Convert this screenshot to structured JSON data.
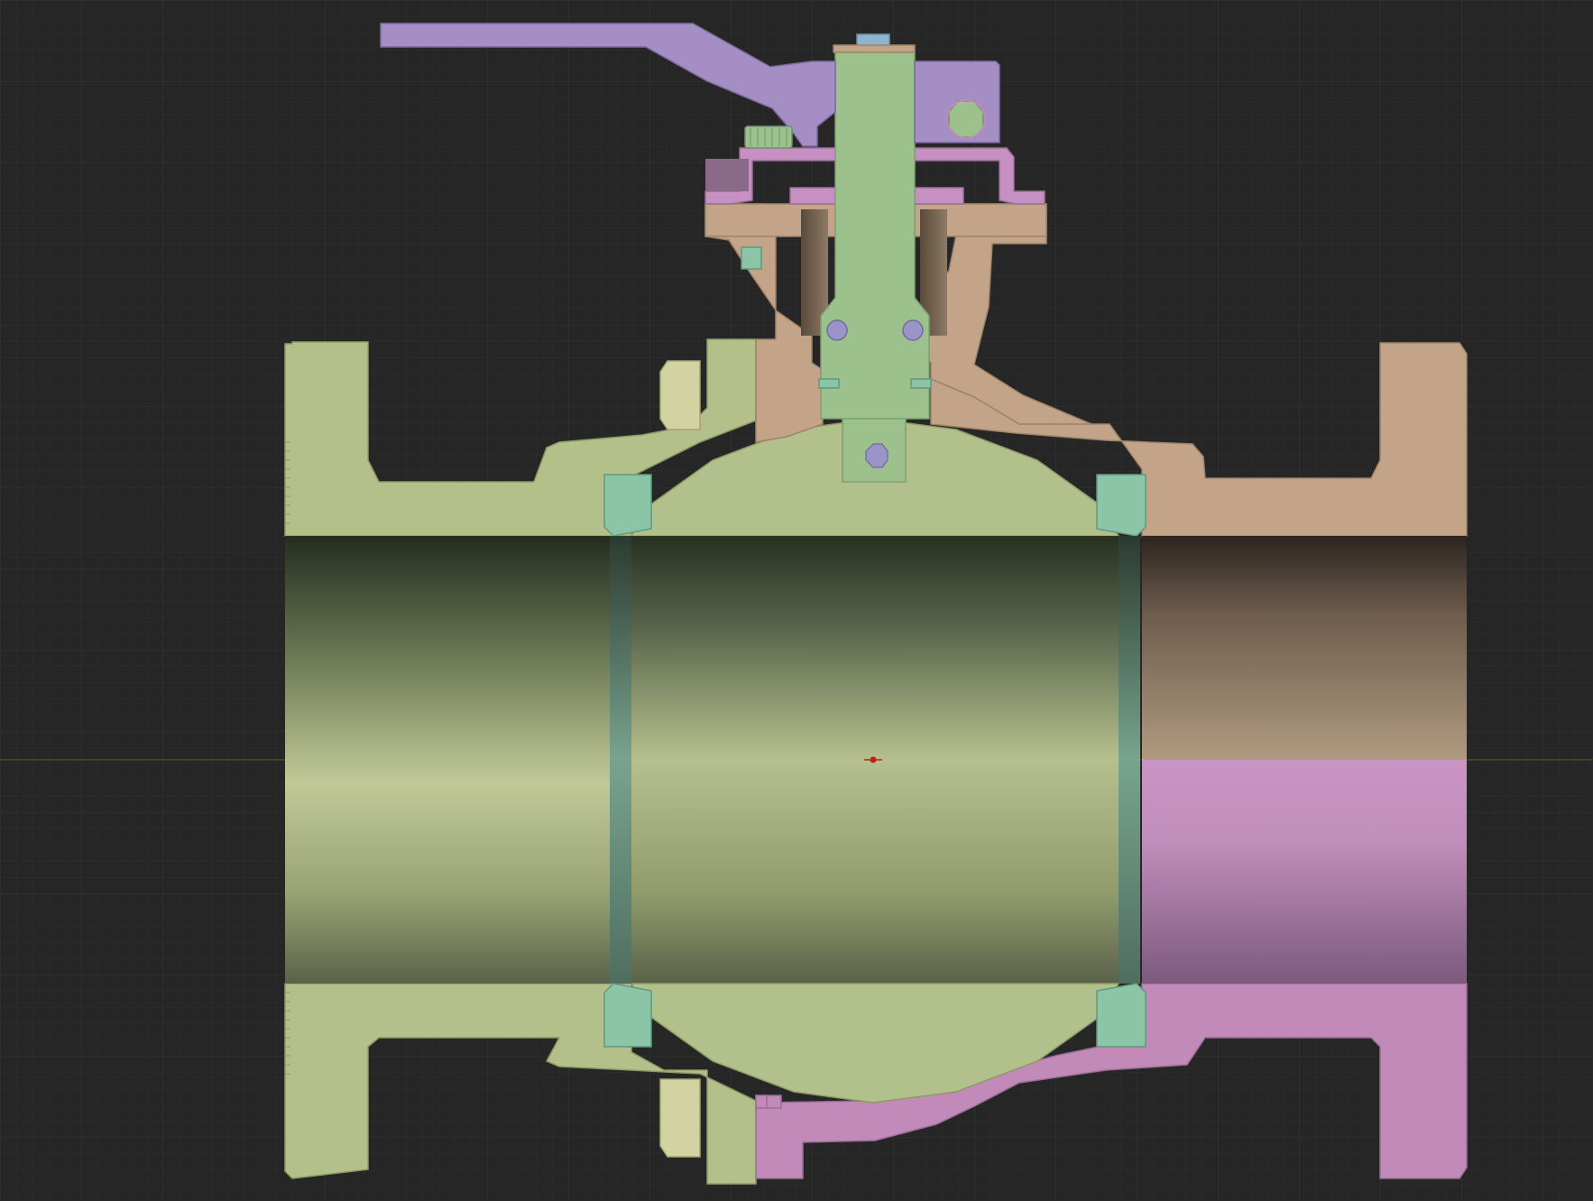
{
  "viewport": {
    "background": "#262626",
    "grid": true,
    "grid_minor_color": "#2f2f2f",
    "grid_major_color": "#343434",
    "horizon_line_color": "#4a4f2a",
    "origin_marker_color": "#c0201a"
  },
  "model": {
    "view": "section cut",
    "parts": [
      {
        "id": "lever-handle",
        "color": "#a48ec4"
      },
      {
        "id": "stem",
        "color": "#9cc18c"
      },
      {
        "id": "stem-nut",
        "color": "#a48ec4"
      },
      {
        "id": "gland-flange",
        "color": "#c690c3"
      },
      {
        "id": "bonnet",
        "color": "#c3a489"
      },
      {
        "id": "body-left",
        "color": "#b4c089"
      },
      {
        "id": "body-right-upper",
        "color": "#c3a489"
      },
      {
        "id": "body-right-lower",
        "color": "#c28ab9"
      },
      {
        "id": "ball",
        "color": "#b2c08c"
      },
      {
        "id": "seat-rings",
        "color": "#8cc4a8"
      },
      {
        "id": "body-bolts",
        "color": "#d2d3a0"
      },
      {
        "id": "stem-o-rings",
        "color": "#9a94c8"
      }
    ]
  }
}
